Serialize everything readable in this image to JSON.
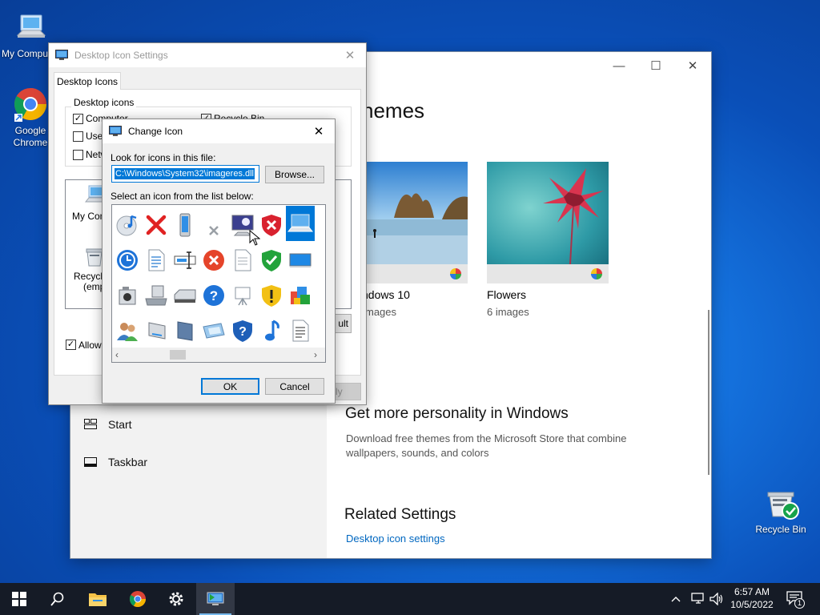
{
  "desktop": {
    "icons": [
      {
        "label": "My Computer"
      },
      {
        "label": "Google Chrome"
      },
      {
        "label": "Recycle Bin"
      }
    ]
  },
  "settings": {
    "heading_partial": "hemes",
    "nav": [
      {
        "label": "Start",
        "icon": "start-layout-icon"
      },
      {
        "label": "Taskbar",
        "icon": "taskbar-icon"
      }
    ],
    "themes": [
      {
        "name": "ndows 10",
        "count": "mages"
      },
      {
        "name": "Flowers",
        "count": "6 images"
      }
    ],
    "personality": {
      "title": "Get more personality in Windows",
      "desc": "Download free themes from the Microsoft Store that combine wallpapers, sounds, and colors"
    },
    "related": {
      "title": "Related Settings",
      "link": "Desktop icon settings"
    }
  },
  "desktop_icon_settings": {
    "title": "Desktop Icon Settings",
    "tab": "Desktop Icons",
    "group_label": "Desktop icons",
    "checkboxes": [
      {
        "label": "Computer",
        "checked": true
      },
      {
        "label": "Recycle Bin",
        "checked": true
      },
      {
        "label": "User",
        "checked": false
      },
      {
        "label": "Netw",
        "checked": false
      }
    ],
    "preview": [
      {
        "label": "My Comp"
      },
      {
        "label": "Recycle"
      },
      {
        "label": "(empt"
      }
    ],
    "allow_themes": {
      "label": "Allow t",
      "checked": true
    },
    "restore_default_partial": "ult",
    "apply_partial": "ly"
  },
  "change_icon": {
    "title": "Change Icon",
    "look_label": "Look for icons in this file:",
    "path_value": "C:\\Windows\\System32\\imageres.dll",
    "browse": "Browse...",
    "select_label": "Select an icon from the list below:",
    "ok": "OK",
    "cancel": "Cancel",
    "selected_icon": "laptop-icon"
  },
  "taskbar": {
    "time": "6:57 AM",
    "date": "10/5/2022",
    "notification_count": "1"
  },
  "colors": {
    "accent": "#0078d7",
    "link": "#0067c0",
    "taskbar": "#151b26"
  }
}
